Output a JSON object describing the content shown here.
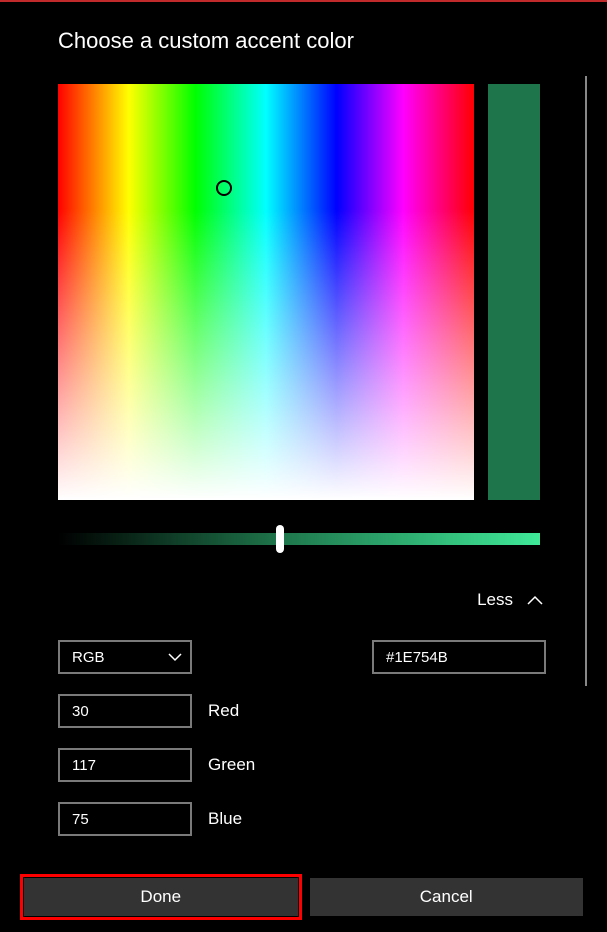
{
  "title": "Choose a custom accent color",
  "swatch_color": "#1E754B",
  "value_gradient_from": "#000000",
  "value_gradient_mid": "#1E754B",
  "value_gradient_to": "#3FE898",
  "less_label": "Less",
  "mode": {
    "selected": "RGB"
  },
  "hex_value": "#1E754B",
  "channels": {
    "red": {
      "value": "30",
      "label": "Red"
    },
    "green": {
      "value": "117",
      "label": "Green"
    },
    "blue": {
      "value": "75",
      "label": "Blue"
    }
  },
  "buttons": {
    "done": "Done",
    "cancel": "Cancel"
  }
}
